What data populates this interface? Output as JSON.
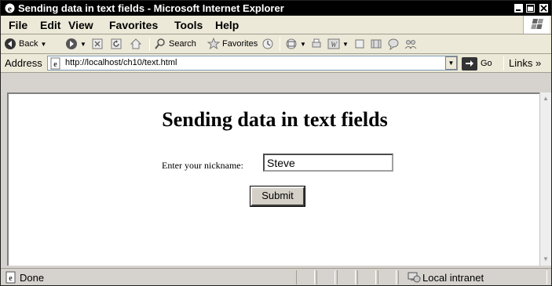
{
  "window": {
    "title": "Sending data in text fields - Microsoft Internet Explorer",
    "icon": "ie-icon",
    "buttons": [
      "minimize-icon",
      "maximize-icon",
      "close-icon"
    ]
  },
  "menubar": {
    "items": [
      {
        "label": "File"
      },
      {
        "label": "Edit"
      },
      {
        "label": "View"
      },
      {
        "label": "Favorites"
      },
      {
        "label": "Tools"
      },
      {
        "label": "Help"
      }
    ]
  },
  "toolbar": {
    "back_label": "Back",
    "search_label": "Search",
    "favorites_label": "Favorites"
  },
  "addressbar": {
    "label": "Address",
    "url": "http://localhost/ch10/text.html",
    "go_label": "Go",
    "links_label": "Links"
  },
  "page": {
    "title": "Sending data in text fields",
    "nickname_label": "Enter your nickname:",
    "nickname_value": "Steve",
    "submit_label": "Submit"
  },
  "statusbar": {
    "status": "Done",
    "zone": "Local intranet"
  }
}
